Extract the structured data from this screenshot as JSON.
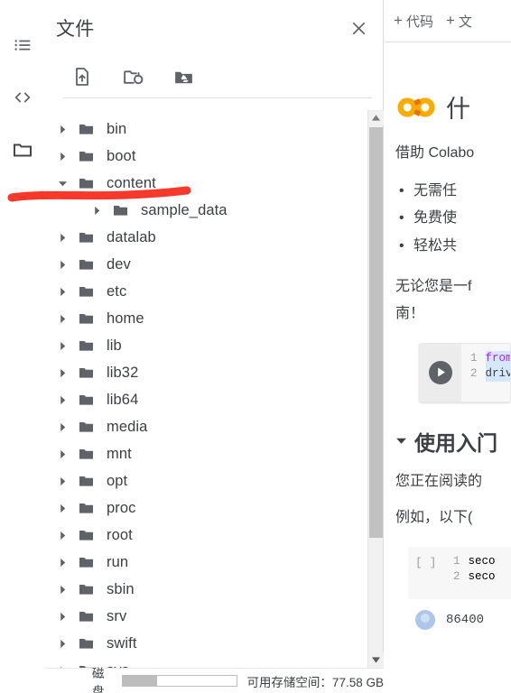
{
  "rail": {
    "items": [
      {
        "icon": "table-of-contents-icon",
        "name": "toc"
      },
      {
        "icon": "code-snippets-icon",
        "name": "snippets"
      },
      {
        "icon": "folder-icon",
        "name": "files"
      }
    ]
  },
  "files_panel": {
    "title": "文件",
    "close_label": "✕",
    "toolbar": [
      {
        "name": "upload-file",
        "icon": "upload-file-icon"
      },
      {
        "name": "refresh-folder",
        "icon": "refresh-folder-icon"
      },
      {
        "name": "mount-drive",
        "icon": "google-drive-icon"
      }
    ],
    "tree": [
      {
        "label": "bin",
        "indent": 0,
        "expanded": false
      },
      {
        "label": "boot",
        "indent": 0,
        "expanded": false
      },
      {
        "label": "content",
        "indent": 0,
        "expanded": true
      },
      {
        "label": "sample_data",
        "indent": 1,
        "expanded": false
      },
      {
        "label": "datalab",
        "indent": 0,
        "expanded": false
      },
      {
        "label": "dev",
        "indent": 0,
        "expanded": false
      },
      {
        "label": "etc",
        "indent": 0,
        "expanded": false
      },
      {
        "label": "home",
        "indent": 0,
        "expanded": false
      },
      {
        "label": "lib",
        "indent": 0,
        "expanded": false
      },
      {
        "label": "lib32",
        "indent": 0,
        "expanded": false
      },
      {
        "label": "lib64",
        "indent": 0,
        "expanded": false
      },
      {
        "label": "media",
        "indent": 0,
        "expanded": false
      },
      {
        "label": "mnt",
        "indent": 0,
        "expanded": false
      },
      {
        "label": "opt",
        "indent": 0,
        "expanded": false
      },
      {
        "label": "proc",
        "indent": 0,
        "expanded": false
      },
      {
        "label": "root",
        "indent": 0,
        "expanded": false
      },
      {
        "label": "run",
        "indent": 0,
        "expanded": false
      },
      {
        "label": "sbin",
        "indent": 0,
        "expanded": false
      },
      {
        "label": "srv",
        "indent": 0,
        "expanded": false
      },
      {
        "label": "swift",
        "indent": 0,
        "expanded": false
      },
      {
        "label": "sys",
        "indent": 0,
        "expanded": false
      }
    ],
    "disk": {
      "label": "磁盘",
      "used_percent": 30,
      "free_text": "可用存储空间：77.58 GB"
    }
  },
  "notebook": {
    "toolbar": {
      "add_code": "代码",
      "add_text": "文",
      "plus": "+"
    },
    "heading1": "什",
    "logo_alt": "colab-logo",
    "intro": "借助 Colabo",
    "bullets": [
      "无需任",
      "免费使",
      "轻松共"
    ],
    "paragraph_line1": "无论您是一f",
    "paragraph_line2": "南！",
    "code_cell_1": {
      "lines": [
        {
          "no": "1",
          "text": "from"
        },
        {
          "no": "2",
          "text": "driv"
        }
      ]
    },
    "heading2": "使用入门",
    "para2_line1": "您正在阅读的",
    "para2_line2": "例如，以下(",
    "code_cell_2": {
      "prompt": "[ ]",
      "lines": [
        {
          "no": "1",
          "text": "seco"
        },
        {
          "no": "2",
          "text": "seco"
        }
      ]
    },
    "output": "86400"
  },
  "annotation": {
    "color": "#f9382c",
    "shape": "horizontal-underline-stroke"
  },
  "colors": {
    "accent_orange": "#f9ab00",
    "accent_orange_dark": "#e8710a",
    "text": "#3c4043",
    "icon": "#5f6368",
    "divider": "#dadce0",
    "annotation_red": "#f9382c"
  }
}
